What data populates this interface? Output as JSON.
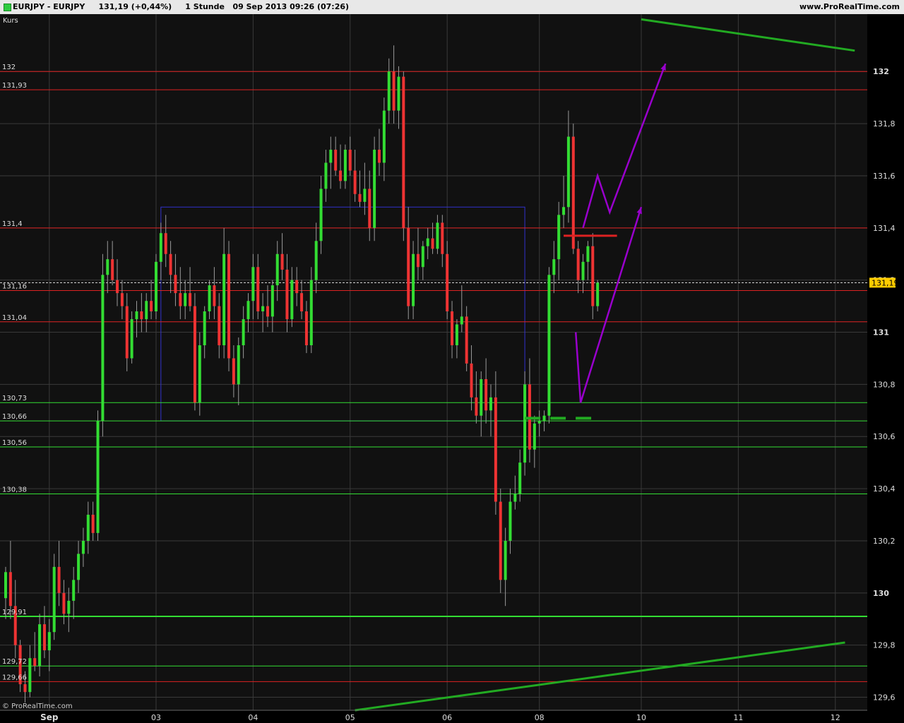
{
  "header": {
    "title": "EURJPY - EURJPY     131,19 (+0,44%)     1 Stunde   09 Sep 2013 09:26 (07:26)",
    "site": "www.ProRealTime.com"
  },
  "panel_label": "Kurs",
  "watermark": "© ProRealTime.com",
  "colors": {
    "background": "#111111",
    "grid": "#3a3a3a",
    "bull": "#33dd33",
    "bear": "#ee3333",
    "support": "#33dd33",
    "resistance": "#dd2222",
    "trend": "#22aa22",
    "forecast": "#9900cc",
    "range_box": "#3333cc",
    "price_tag": "#ffcc00"
  },
  "chart_data": {
    "type": "candlestick",
    "symbol": "EURJPY",
    "timeframe": "1 Stunde",
    "last_price": "131,19",
    "ylim": [
      129.55,
      132.22
    ],
    "y_ticks": [
      {
        "v": 132,
        "label": "132"
      },
      {
        "v": 131.8,
        "label": "131,8"
      },
      {
        "v": 131.6,
        "label": "131,6"
      },
      {
        "v": 131.4,
        "label": "131,4"
      },
      {
        "v": 131.2,
        "label": "131,2"
      },
      {
        "v": 131,
        "label": "131"
      },
      {
        "v": 130.8,
        "label": "130,8"
      },
      {
        "v": 130.6,
        "label": "130,6"
      },
      {
        "v": 130.4,
        "label": "130,4"
      },
      {
        "v": 130.2,
        "label": "130,2"
      },
      {
        "v": 130,
        "label": "130"
      },
      {
        "v": 129.8,
        "label": "129,8"
      },
      {
        "v": 129.6,
        "label": "129,6"
      }
    ],
    "x_ticks": [
      {
        "i": 9,
        "label": "Sep"
      },
      {
        "i": 31,
        "label": "03"
      },
      {
        "i": 51,
        "label": "04"
      },
      {
        "i": 71,
        "label": "05"
      },
      {
        "i": 91,
        "label": "06"
      },
      {
        "i": 110,
        "label": "08"
      },
      {
        "i": 131,
        "label": "10"
      },
      {
        "i": 151,
        "label": "11"
      },
      {
        "i": 171,
        "label": "12"
      }
    ],
    "resistance_levels": [
      {
        "v": 132,
        "label": "132"
      },
      {
        "v": 131.93,
        "label": "131,93"
      },
      {
        "v": 131.4,
        "label": "131,4"
      },
      {
        "v": 131.16,
        "label": "131,16"
      },
      {
        "v": 131.04,
        "label": "131,04"
      },
      {
        "v": 129.66,
        "label": "129,66"
      }
    ],
    "support_levels": [
      {
        "v": 130.73,
        "label": "130,73"
      },
      {
        "v": 130.66,
        "label": "130,66"
      },
      {
        "v": 130.56,
        "label": "130,56"
      },
      {
        "v": 130.38,
        "label": "130,38"
      },
      {
        "v": 129.91,
        "label": "129,91"
      },
      {
        "v": 129.72,
        "label": "129,72"
      }
    ],
    "trendlines": [
      {
        "from": [
          72,
          129.55
        ],
        "to": [
          173,
          129.81
        ]
      },
      {
        "from": [
          131,
          132.2
        ],
        "to": [
          175,
          132.08
        ]
      }
    ],
    "range_box": {
      "x0": 32,
      "x1": 107,
      "y0": 130.66,
      "y1": 131.48
    },
    "forecast_paths": [
      [
        [
          117.5,
          131.0
        ],
        [
          118.5,
          130.73
        ],
        [
          131,
          131.48
        ]
      ],
      [
        [
          119,
          131.4
        ],
        [
          122,
          131.6
        ],
        [
          124.5,
          131.46
        ],
        [
          136,
          132.03
        ]
      ]
    ],
    "marker_levels": [
      {
        "type": "resistance",
        "from": 115,
        "to": 126,
        "v": 131.37
      },
      {
        "type": "support",
        "from": 107,
        "to": 121,
        "v": 130.67
      }
    ],
    "candles": [
      {
        "o": 129.98,
        "h": 130.1,
        "l": 129.9,
        "c": 130.08
      },
      {
        "o": 130.08,
        "h": 130.2,
        "l": 129.9,
        "c": 129.95
      },
      {
        "o": 129.95,
        "h": 130.05,
        "l": 129.75,
        "c": 129.8
      },
      {
        "o": 129.8,
        "h": 129.82,
        "l": 129.62,
        "c": 129.65
      },
      {
        "o": 129.65,
        "h": 129.7,
        "l": 129.58,
        "c": 129.62
      },
      {
        "o": 129.62,
        "h": 129.8,
        "l": 129.6,
        "c": 129.75
      },
      {
        "o": 129.75,
        "h": 129.85,
        "l": 129.7,
        "c": 129.72
      },
      {
        "o": 129.72,
        "h": 129.92,
        "l": 129.68,
        "c": 129.88
      },
      {
        "o": 129.88,
        "h": 129.95,
        "l": 129.75,
        "c": 129.78
      },
      {
        "o": 129.78,
        "h": 129.9,
        "l": 129.7,
        "c": 129.85
      },
      {
        "o": 129.85,
        "h": 130.15,
        "l": 129.82,
        "c": 130.1
      },
      {
        "o": 130.1,
        "h": 130.2,
        "l": 129.95,
        "c": 130.0
      },
      {
        "o": 130.0,
        "h": 130.05,
        "l": 129.88,
        "c": 129.92
      },
      {
        "o": 129.92,
        "h": 130.02,
        "l": 129.85,
        "c": 129.97
      },
      {
        "o": 129.97,
        "h": 130.1,
        "l": 129.9,
        "c": 130.05
      },
      {
        "o": 130.05,
        "h": 130.2,
        "l": 130.0,
        "c": 130.15
      },
      {
        "o": 130.15,
        "h": 130.25,
        "l": 130.1,
        "c": 130.2
      },
      {
        "o": 130.2,
        "h": 130.35,
        "l": 130.15,
        "c": 130.3
      },
      {
        "o": 130.3,
        "h": 130.35,
        "l": 130.2,
        "c": 130.23
      },
      {
        "o": 130.23,
        "h": 130.7,
        "l": 130.2,
        "c": 130.66
      },
      {
        "o": 130.66,
        "h": 131.3,
        "l": 130.6,
        "c": 131.22
      },
      {
        "o": 131.22,
        "h": 131.35,
        "l": 131.15,
        "c": 131.28
      },
      {
        "o": 131.28,
        "h": 131.35,
        "l": 131.18,
        "c": 131.2
      },
      {
        "o": 131.2,
        "h": 131.28,
        "l": 131.1,
        "c": 131.15
      },
      {
        "o": 131.15,
        "h": 131.2,
        "l": 131.05,
        "c": 131.1
      },
      {
        "o": 131.1,
        "h": 131.15,
        "l": 130.85,
        "c": 130.9
      },
      {
        "o": 130.9,
        "h": 131.08,
        "l": 130.88,
        "c": 131.05
      },
      {
        "o": 131.05,
        "h": 131.12,
        "l": 130.98,
        "c": 131.08
      },
      {
        "o": 131.08,
        "h": 131.15,
        "l": 131.0,
        "c": 131.05
      },
      {
        "o": 131.05,
        "h": 131.15,
        "l": 131.0,
        "c": 131.12
      },
      {
        "o": 131.12,
        "h": 131.2,
        "l": 131.05,
        "c": 131.08
      },
      {
        "o": 131.08,
        "h": 131.3,
        "l": 131.05,
        "c": 131.27
      },
      {
        "o": 131.27,
        "h": 131.42,
        "l": 131.2,
        "c": 131.38
      },
      {
        "o": 131.38,
        "h": 131.45,
        "l": 131.25,
        "c": 131.3
      },
      {
        "o": 131.3,
        "h": 131.35,
        "l": 131.15,
        "c": 131.22
      },
      {
        "o": 131.22,
        "h": 131.3,
        "l": 131.1,
        "c": 131.15
      },
      {
        "o": 131.15,
        "h": 131.25,
        "l": 131.05,
        "c": 131.1
      },
      {
        "o": 131.1,
        "h": 131.2,
        "l": 131.05,
        "c": 131.15
      },
      {
        "o": 131.15,
        "h": 131.25,
        "l": 131.08,
        "c": 131.1
      },
      {
        "o": 131.1,
        "h": 131.15,
        "l": 130.7,
        "c": 130.73
      },
      {
        "o": 130.73,
        "h": 131.0,
        "l": 130.68,
        "c": 130.95
      },
      {
        "o": 130.95,
        "h": 131.1,
        "l": 130.9,
        "c": 131.08
      },
      {
        "o": 131.08,
        "h": 131.2,
        "l": 131.05,
        "c": 131.18
      },
      {
        "o": 131.18,
        "h": 131.25,
        "l": 131.05,
        "c": 131.1
      },
      {
        "o": 131.1,
        "h": 131.15,
        "l": 130.9,
        "c": 130.95
      },
      {
        "o": 130.95,
        "h": 131.4,
        "l": 130.9,
        "c": 131.3
      },
      {
        "o": 131.3,
        "h": 131.35,
        "l": 130.85,
        "c": 130.9
      },
      {
        "o": 130.9,
        "h": 130.95,
        "l": 130.75,
        "c": 130.8
      },
      {
        "o": 130.8,
        "h": 130.98,
        "l": 130.72,
        "c": 130.95
      },
      {
        "o": 130.95,
        "h": 131.1,
        "l": 130.9,
        "c": 131.05
      },
      {
        "o": 131.05,
        "h": 131.15,
        "l": 131.0,
        "c": 131.12
      },
      {
        "o": 131.12,
        "h": 131.3,
        "l": 131.05,
        "c": 131.25
      },
      {
        "o": 131.25,
        "h": 131.3,
        "l": 131.05,
        "c": 131.08
      },
      {
        "o": 131.08,
        "h": 131.15,
        "l": 131.0,
        "c": 131.1
      },
      {
        "o": 131.1,
        "h": 131.18,
        "l": 131.02,
        "c": 131.06
      },
      {
        "o": 131.06,
        "h": 131.2,
        "l": 131.0,
        "c": 131.18
      },
      {
        "o": 131.18,
        "h": 131.35,
        "l": 131.12,
        "c": 131.3
      },
      {
        "o": 131.3,
        "h": 131.38,
        "l": 131.2,
        "c": 131.24
      },
      {
        "o": 131.24,
        "h": 131.3,
        "l": 131.0,
        "c": 131.05
      },
      {
        "o": 131.05,
        "h": 131.25,
        "l": 131.02,
        "c": 131.2
      },
      {
        "o": 131.2,
        "h": 131.25,
        "l": 131.1,
        "c": 131.15
      },
      {
        "o": 131.15,
        "h": 131.2,
        "l": 131.05,
        "c": 131.08
      },
      {
        "o": 131.08,
        "h": 131.12,
        "l": 130.92,
        "c": 130.95
      },
      {
        "o": 130.95,
        "h": 131.25,
        "l": 130.92,
        "c": 131.2
      },
      {
        "o": 131.2,
        "h": 131.42,
        "l": 131.15,
        "c": 131.35
      },
      {
        "o": 131.35,
        "h": 131.6,
        "l": 131.3,
        "c": 131.55
      },
      {
        "o": 131.55,
        "h": 131.7,
        "l": 131.5,
        "c": 131.65
      },
      {
        "o": 131.65,
        "h": 131.75,
        "l": 131.55,
        "c": 131.7
      },
      {
        "o": 131.7,
        "h": 131.75,
        "l": 131.6,
        "c": 131.62
      },
      {
        "o": 131.62,
        "h": 131.72,
        "l": 131.55,
        "c": 131.58
      },
      {
        "o": 131.58,
        "h": 131.72,
        "l": 131.55,
        "c": 131.7
      },
      {
        "o": 131.7,
        "h": 131.75,
        "l": 131.6,
        "c": 131.62
      },
      {
        "o": 131.62,
        "h": 131.7,
        "l": 131.5,
        "c": 131.53
      },
      {
        "o": 131.53,
        "h": 131.62,
        "l": 131.48,
        "c": 131.5
      },
      {
        "o": 131.5,
        "h": 131.65,
        "l": 131.45,
        "c": 131.55
      },
      {
        "o": 131.55,
        "h": 131.62,
        "l": 131.35,
        "c": 131.4
      },
      {
        "o": 131.4,
        "h": 131.75,
        "l": 131.35,
        "c": 131.7
      },
      {
        "o": 131.7,
        "h": 131.78,
        "l": 131.6,
        "c": 131.65
      },
      {
        "o": 131.65,
        "h": 131.9,
        "l": 131.58,
        "c": 131.85
      },
      {
        "o": 131.85,
        "h": 132.05,
        "l": 131.8,
        "c": 132.0
      },
      {
        "o": 132.0,
        "h": 132.1,
        "l": 131.8,
        "c": 131.85
      },
      {
        "o": 131.85,
        "h": 132.02,
        "l": 131.78,
        "c": 131.98
      },
      {
        "o": 131.98,
        "h": 132.0,
        "l": 131.35,
        "c": 131.4
      },
      {
        "o": 131.4,
        "h": 131.48,
        "l": 131.05,
        "c": 131.1
      },
      {
        "o": 131.1,
        "h": 131.35,
        "l": 131.05,
        "c": 131.3
      },
      {
        "o": 131.3,
        "h": 131.4,
        "l": 131.2,
        "c": 131.25
      },
      {
        "o": 131.25,
        "h": 131.35,
        "l": 131.2,
        "c": 131.33
      },
      {
        "o": 131.33,
        "h": 131.4,
        "l": 131.28,
        "c": 131.36
      },
      {
        "o": 131.36,
        "h": 131.42,
        "l": 131.3,
        "c": 131.32
      },
      {
        "o": 131.32,
        "h": 131.45,
        "l": 131.3,
        "c": 131.42
      },
      {
        "o": 131.42,
        "h": 131.45,
        "l": 131.25,
        "c": 131.3
      },
      {
        "o": 131.3,
        "h": 131.35,
        "l": 131.05,
        "c": 131.08
      },
      {
        "o": 131.08,
        "h": 131.12,
        "l": 130.9,
        "c": 130.95
      },
      {
        "o": 130.95,
        "h": 131.05,
        "l": 130.9,
        "c": 131.03
      },
      {
        "o": 131.03,
        "h": 131.18,
        "l": 131.0,
        "c": 131.06
      },
      {
        "o": 131.06,
        "h": 131.1,
        "l": 130.85,
        "c": 130.88
      },
      {
        "o": 130.88,
        "h": 130.95,
        "l": 130.7,
        "c": 130.75
      },
      {
        "o": 130.75,
        "h": 130.85,
        "l": 130.65,
        "c": 130.68
      },
      {
        "o": 130.68,
        "h": 130.85,
        "l": 130.6,
        "c": 130.82
      },
      {
        "o": 130.82,
        "h": 130.9,
        "l": 130.65,
        "c": 130.7
      },
      {
        "o": 130.7,
        "h": 130.8,
        "l": 130.6,
        "c": 130.75
      },
      {
        "o": 130.75,
        "h": 130.85,
        "l": 130.3,
        "c": 130.35
      },
      {
        "o": 130.35,
        "h": 130.4,
        "l": 130.0,
        "c": 130.05
      },
      {
        "o": 130.05,
        "h": 130.25,
        "l": 129.95,
        "c": 130.2
      },
      {
        "o": 130.2,
        "h": 130.4,
        "l": 130.15,
        "c": 130.35
      },
      {
        "o": 130.35,
        "h": 130.45,
        "l": 130.32,
        "c": 130.38
      },
      {
        "o": 130.38,
        "h": 130.55,
        "l": 130.35,
        "c": 130.5
      },
      {
        "o": 130.5,
        "h": 130.85,
        "l": 130.45,
        "c": 130.8
      },
      {
        "o": 130.8,
        "h": 130.9,
        "l": 130.5,
        "c": 130.55
      },
      {
        "o": 130.55,
        "h": 130.68,
        "l": 130.48,
        "c": 130.65
      },
      {
        "o": 130.65,
        "h": 130.7,
        "l": 130.6,
        "c": 130.66
      },
      {
        "o": 130.66,
        "h": 130.7,
        "l": 130.62,
        "c": 130.68
      },
      {
        "o": 130.68,
        "h": 131.25,
        "l": 130.65,
        "c": 131.22
      },
      {
        "o": 131.22,
        "h": 131.35,
        "l": 131.15,
        "c": 131.28
      },
      {
        "o": 131.28,
        "h": 131.5,
        "l": 131.2,
        "c": 131.45
      },
      {
        "o": 131.45,
        "h": 131.6,
        "l": 131.4,
        "c": 131.48
      },
      {
        "o": 131.48,
        "h": 131.85,
        "l": 131.42,
        "c": 131.75
      },
      {
        "o": 131.75,
        "h": 131.8,
        "l": 131.3,
        "c": 131.32
      },
      {
        "o": 131.32,
        "h": 131.35,
        "l": 131.15,
        "c": 131.2
      },
      {
        "o": 131.2,
        "h": 131.3,
        "l": 131.15,
        "c": 131.27
      },
      {
        "o": 131.27,
        "h": 131.35,
        "l": 131.2,
        "c": 131.33
      },
      {
        "o": 131.33,
        "h": 131.38,
        "l": 131.05,
        "c": 131.1
      },
      {
        "o": 131.1,
        "h": 131.2,
        "l": 131.08,
        "c": 131.19
      }
    ]
  }
}
